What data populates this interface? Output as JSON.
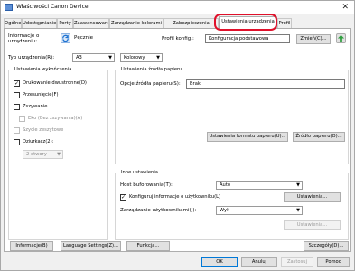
{
  "window": {
    "title": "Właściwości Canon Device",
    "close_glyph": "✕"
  },
  "tabs": [
    {
      "label": "Ogólne"
    },
    {
      "label": "Udostępnianie"
    },
    {
      "label": "Porty"
    },
    {
      "label": "Zaawansowane"
    },
    {
      "label": "Zarządzanie kolorami"
    },
    {
      "label": "Zabezpieczenia"
    },
    {
      "label": "Ustawienia urządzenia"
    },
    {
      "label": "Profil"
    }
  ],
  "device_info": {
    "label_line1": "Informacje o",
    "label_line2": "urządzeniu:",
    "refresh_label": "Pęcznie",
    "profile_label": "Profil konfig.:",
    "profile_value": "Konfiguracja podstawowa",
    "change_button": "Zmień(C)..."
  },
  "device_type": {
    "label": "Typ urządzenia(R):",
    "paper_value": "A3",
    "color_value": "Kolorowy"
  },
  "output_options": {
    "title": "Ustawienia wykończenia",
    "duplex": "Drukowanie dwustronne(D)",
    "offset": "Przesunięcie(F)",
    "staple": "Zszywanie",
    "eco_staple": "Eko (Bez zszywania)(A)",
    "saddle_stitch": "Szycie zeszytowe",
    "punch": "Dziurkacz(2):",
    "punch_select": "2 otwory"
  },
  "paper_source": {
    "title": "Ustawienia źródła papieru",
    "option_label": "Opcje źródła papieru(S):",
    "option_value": "Brak",
    "format_button": "Ustawienia formatu papieru(U)...",
    "source_button": "Źródło papieru(O)..."
  },
  "other_settings": {
    "title": "Inne ustawienia",
    "spool_label": "Host buforowania(T):",
    "spool_value": "Auto",
    "config_user_info": "Konfiguruj informacje o użytkowniku(L)",
    "settings_button": "Ustawienia...",
    "user_mgmt_label": "Zarządzanie użytkownikami(J):",
    "user_mgmt_value": "Wył.",
    "settings_button2": "Ustawienia..."
  },
  "bottom_buttons": {
    "info": "Informacje(B)",
    "language": "Language Settings(Z)...",
    "function": "Funkcja...",
    "details": "Szczegóły(D)..."
  },
  "dialog_buttons": {
    "ok": "OK",
    "cancel": "Anuluj",
    "apply": "Zastosuj",
    "help": "Pomoc"
  },
  "colors": {
    "highlight": "#e0102a",
    "refresh_icon": "#1e73d2",
    "export_icon": "#2e9e3e"
  }
}
